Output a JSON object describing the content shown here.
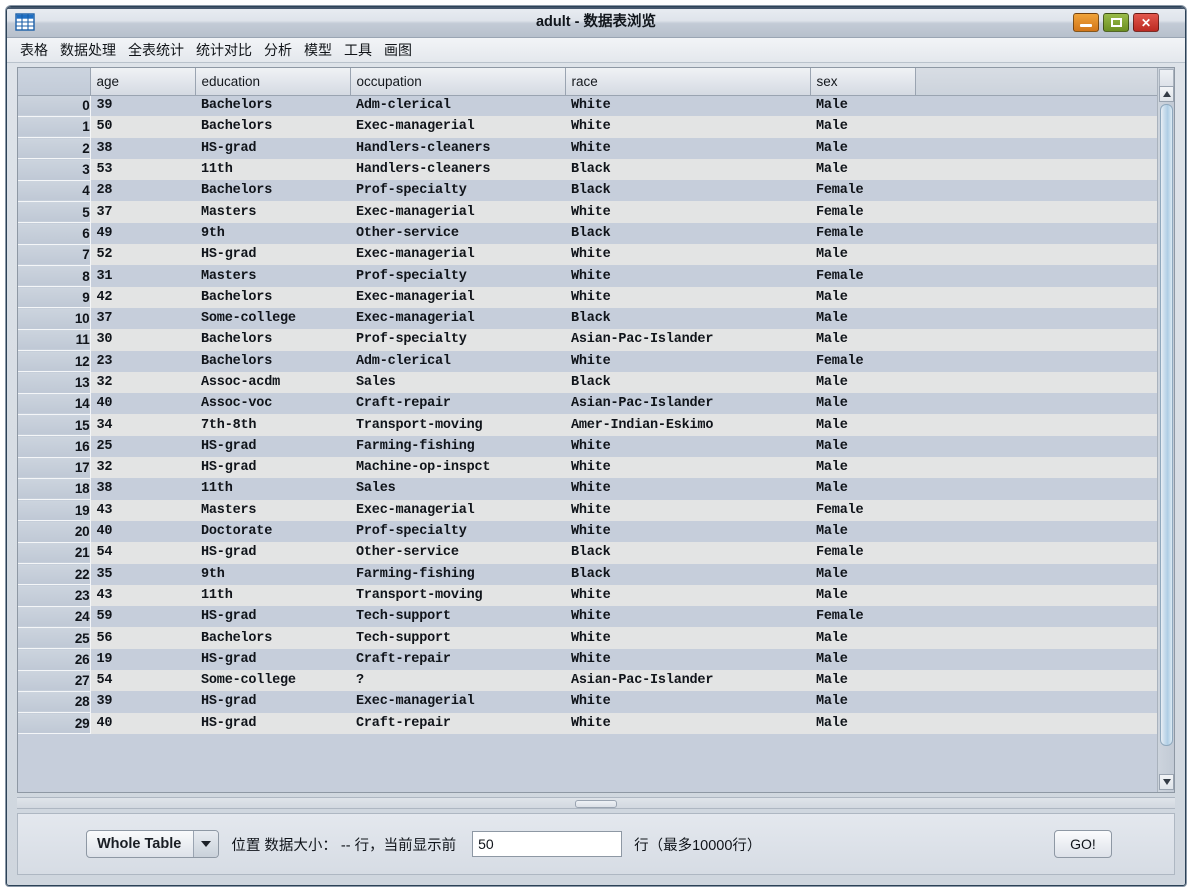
{
  "window": {
    "title": "adult - 数据表浏览",
    "icon": "table-icon",
    "controls": {
      "minimize": "minimize-icon",
      "maximize": "maximize-icon",
      "close": "close-icon"
    }
  },
  "menubar": {
    "items": [
      {
        "label": "表格"
      },
      {
        "label": "数据处理"
      },
      {
        "label": "全表统计"
      },
      {
        "label": "统计对比"
      },
      {
        "label": "分析"
      },
      {
        "label": "模型"
      },
      {
        "label": "工具"
      },
      {
        "label": "画图"
      }
    ]
  },
  "table": {
    "index_header": "",
    "columns": [
      "age",
      "education",
      "occupation",
      "race",
      "sex"
    ],
    "rows": [
      {
        "idx": "0",
        "age": "39",
        "education": "Bachelors",
        "occupation": "Adm-clerical",
        "race": "White",
        "sex": "Male"
      },
      {
        "idx": "1",
        "age": "50",
        "education": "Bachelors",
        "occupation": "Exec-managerial",
        "race": "White",
        "sex": "Male"
      },
      {
        "idx": "2",
        "age": "38",
        "education": "HS-grad",
        "occupation": "Handlers-cleaners",
        "race": "White",
        "sex": "Male"
      },
      {
        "idx": "3",
        "age": "53",
        "education": "11th",
        "occupation": "Handlers-cleaners",
        "race": "Black",
        "sex": "Male"
      },
      {
        "idx": "4",
        "age": "28",
        "education": "Bachelors",
        "occupation": "Prof-specialty",
        "race": "Black",
        "sex": "Female"
      },
      {
        "idx": "5",
        "age": "37",
        "education": "Masters",
        "occupation": "Exec-managerial",
        "race": "White",
        "sex": "Female"
      },
      {
        "idx": "6",
        "age": "49",
        "education": "9th",
        "occupation": "Other-service",
        "race": "Black",
        "sex": "Female"
      },
      {
        "idx": "7",
        "age": "52",
        "education": "HS-grad",
        "occupation": "Exec-managerial",
        "race": "White",
        "sex": "Male"
      },
      {
        "idx": "8",
        "age": "31",
        "education": "Masters",
        "occupation": "Prof-specialty",
        "race": "White",
        "sex": "Female"
      },
      {
        "idx": "9",
        "age": "42",
        "education": "Bachelors",
        "occupation": "Exec-managerial",
        "race": "White",
        "sex": "Male"
      },
      {
        "idx": "10",
        "age": "37",
        "education": "Some-college",
        "occupation": "Exec-managerial",
        "race": "Black",
        "sex": "Male"
      },
      {
        "idx": "11",
        "age": "30",
        "education": "Bachelors",
        "occupation": "Prof-specialty",
        "race": "Asian-Pac-Islander",
        "sex": "Male"
      },
      {
        "idx": "12",
        "age": "23",
        "education": "Bachelors",
        "occupation": "Adm-clerical",
        "race": "White",
        "sex": "Female"
      },
      {
        "idx": "13",
        "age": "32",
        "education": "Assoc-acdm",
        "occupation": "Sales",
        "race": "Black",
        "sex": "Male"
      },
      {
        "idx": "14",
        "age": "40",
        "education": "Assoc-voc",
        "occupation": "Craft-repair",
        "race": "Asian-Pac-Islander",
        "sex": "Male"
      },
      {
        "idx": "15",
        "age": "34",
        "education": "7th-8th",
        "occupation": "Transport-moving",
        "race": "Amer-Indian-Eskimo",
        "sex": "Male"
      },
      {
        "idx": "16",
        "age": "25",
        "education": "HS-grad",
        "occupation": "Farming-fishing",
        "race": "White",
        "sex": "Male"
      },
      {
        "idx": "17",
        "age": "32",
        "education": "HS-grad",
        "occupation": "Machine-op-inspct",
        "race": "White",
        "sex": "Male"
      },
      {
        "idx": "18",
        "age": "38",
        "education": "11th",
        "occupation": "Sales",
        "race": "White",
        "sex": "Male"
      },
      {
        "idx": "19",
        "age": "43",
        "education": "Masters",
        "occupation": "Exec-managerial",
        "race": "White",
        "sex": "Female"
      },
      {
        "idx": "20",
        "age": "40",
        "education": "Doctorate",
        "occupation": "Prof-specialty",
        "race": "White",
        "sex": "Male"
      },
      {
        "idx": "21",
        "age": "54",
        "education": "HS-grad",
        "occupation": "Other-service",
        "race": "Black",
        "sex": "Female"
      },
      {
        "idx": "22",
        "age": "35",
        "education": "9th",
        "occupation": "Farming-fishing",
        "race": "Black",
        "sex": "Male"
      },
      {
        "idx": "23",
        "age": "43",
        "education": "11th",
        "occupation": "Transport-moving",
        "race": "White",
        "sex": "Male"
      },
      {
        "idx": "24",
        "age": "59",
        "education": "HS-grad",
        "occupation": "Tech-support",
        "race": "White",
        "sex": "Female"
      },
      {
        "idx": "25",
        "age": "56",
        "education": "Bachelors",
        "occupation": "Tech-support",
        "race": "White",
        "sex": "Male"
      },
      {
        "idx": "26",
        "age": "19",
        "education": "HS-grad",
        "occupation": "Craft-repair",
        "race": "White",
        "sex": "Male"
      },
      {
        "idx": "27",
        "age": "54",
        "education": "Some-college",
        "occupation": "?",
        "race": "Asian-Pac-Islander",
        "sex": "Male"
      },
      {
        "idx": "28",
        "age": "39",
        "education": "HS-grad",
        "occupation": "Exec-managerial",
        "race": "White",
        "sex": "Male"
      },
      {
        "idx": "29",
        "age": "40",
        "education": "HS-grad",
        "occupation": "Craft-repair",
        "race": "White",
        "sex": "Male"
      }
    ]
  },
  "scrollbar": {
    "up_arrow": "scroll-up-icon",
    "down_arrow": "scroll-down-icon"
  },
  "bottombar": {
    "scope_select": "Whole Table",
    "scope_arrow": "chevron-down-icon",
    "size_text": "位置 数据大小： -- 行，当前显示前",
    "rows_value": "50",
    "rows_placeholder": "50",
    "limit_text": "行（最多10000行）",
    "go_label": "GO!"
  },
  "colors": {
    "row_even": "#c6cedb",
    "row_odd": "#e3e4e4",
    "accent": "#aecde4",
    "close": "#bc2a22",
    "minimize": "#d2761a",
    "maximize": "#6c8f22"
  }
}
